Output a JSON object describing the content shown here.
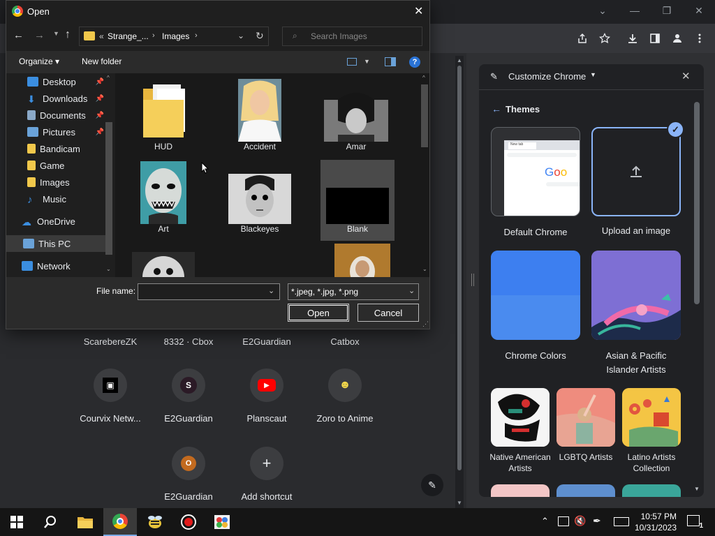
{
  "browser": {
    "window_controls": {
      "dropdown": "⌄",
      "minimize": "—",
      "restore": "❐",
      "close": "✕"
    },
    "toolbar": {
      "share_icon": "share-icon",
      "star_icon": "star-icon",
      "download_icon": "download-icon",
      "sidepanel_icon": "side-panel-icon",
      "profile_icon": "profile-icon",
      "menu_icon": "menu-icon"
    }
  },
  "ntp": {
    "top_labels": [
      "ScarebereZK",
      "8332 · Cbox",
      "E2Guardian",
      "Catbox"
    ],
    "shortcuts_row2": [
      {
        "label": "Courvix Netw...",
        "glyph": "▣",
        "color": "#000000"
      },
      {
        "label": "E2Guardian",
        "glyph": "S",
        "color": "#2b1a26"
      },
      {
        "label": "Planscaut",
        "glyph": "▶",
        "color": "#ff0000"
      },
      {
        "label": "Zoro to Anime",
        "glyph": "☻",
        "color": "#1e2a3a"
      }
    ],
    "shortcuts_row3": [
      {
        "label": "E2Guardian",
        "glyph": "O",
        "color": "#c26a1f"
      },
      {
        "label": "Add shortcut",
        "glyph": "+",
        "color": "#3c3d40"
      }
    ],
    "edit_icon": "✎"
  },
  "sidepanel": {
    "title": "Customize Chrome",
    "section": "Themes",
    "themes": [
      {
        "label": "Default Chrome"
      },
      {
        "label": "Upload an image"
      },
      {
        "label": "Chrome Colors"
      },
      {
        "label": "Asian & Pacific Islander Artists"
      },
      {
        "label": "Native American Artists"
      },
      {
        "label": "LGBTQ Artists"
      },
      {
        "label": "Latino Artists Collection"
      }
    ],
    "preview_text": "Goo",
    "preview_tab": "New tab"
  },
  "dialog": {
    "title": "Open",
    "path": {
      "prefix": "«",
      "seg1": "Strange_...",
      "seg2": "Images"
    },
    "search_placeholder": "Search Images",
    "organize": "Organize ▾",
    "new_folder": "New folder",
    "nav_items": [
      {
        "label": "Desktop",
        "color": "#3b8ee0",
        "pinned": true
      },
      {
        "label": "Downloads",
        "color": "#3b8ee0",
        "pinned": true
      },
      {
        "label": "Documents",
        "color": "#8aa9c8",
        "pinned": true
      },
      {
        "label": "Pictures",
        "color": "#6aa2d8",
        "pinned": true
      },
      {
        "label": "Bandicam",
        "color": "#f1c84b",
        "pinned": false
      },
      {
        "label": "Game",
        "color": "#f1c84b",
        "pinned": false
      },
      {
        "label": "Images",
        "color": "#f1c84b",
        "pinned": false
      },
      {
        "label": "Music",
        "color": "#3b8ee0",
        "pinned": false
      }
    ],
    "nav_onedrive": "OneDrive",
    "nav_thispc": "This PC",
    "nav_network": "Network",
    "files": [
      {
        "label": "HUD",
        "kind": "folder"
      },
      {
        "label": "Accident",
        "kind": "photo"
      },
      {
        "label": "Amar",
        "kind": "photo"
      },
      {
        "label": "Art",
        "kind": "photo"
      },
      {
        "label": "Blackeyes",
        "kind": "photo"
      },
      {
        "label": "Blank",
        "kind": "photo"
      }
    ],
    "filename_label": "File name:",
    "filename_value": "",
    "filter_value": "*.jpeg, *.jpg, *.png",
    "open_btn": "Open",
    "cancel_btn": "Cancel"
  },
  "taskbar": {
    "time": "10:57 PM",
    "date": "10/31/2023",
    "notification_count": "1"
  }
}
